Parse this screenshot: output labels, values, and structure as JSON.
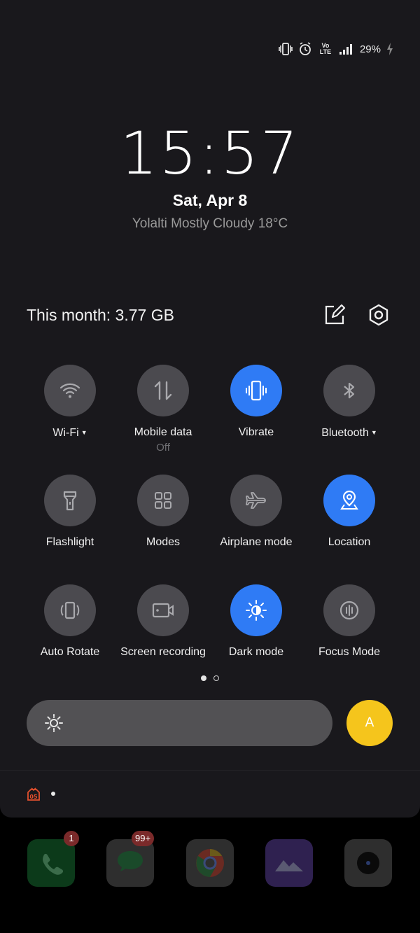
{
  "status_bar": {
    "network_label": "Vo LTE",
    "battery_percent": "29%",
    "icons": [
      "vibrate-icon",
      "alarm-icon",
      "volte-icon",
      "signal-icon",
      "battery-charging-icon"
    ]
  },
  "clock": {
    "time": "15:57",
    "date": "Sat, Apr 8",
    "weather": "Yolalti Mostly Cloudy 18°C"
  },
  "data_usage": {
    "text": "This month: 3.77 GB"
  },
  "toolbar": {
    "icons": [
      "edit-icon",
      "settings-icon"
    ]
  },
  "tiles": [
    {
      "label": "Wi-Fi",
      "icon": "wifi-icon",
      "active": false,
      "has_dropdown": true
    },
    {
      "label": "Mobile data",
      "sub": "Off",
      "icon": "mobile-data-icon",
      "active": false
    },
    {
      "label": "Vibrate",
      "icon": "vibrate-icon",
      "active": true
    },
    {
      "label": "Bluetooth",
      "icon": "bluetooth-icon",
      "active": false,
      "has_dropdown": true
    },
    {
      "label": "Flashlight",
      "icon": "flashlight-icon",
      "active": false
    },
    {
      "label": "Modes",
      "icon": "modes-icon",
      "active": false
    },
    {
      "label": "Airplane mode",
      "icon": "airplane-icon",
      "active": false
    },
    {
      "label": "Location",
      "icon": "location-icon",
      "active": true
    },
    {
      "label": "Auto Rotate",
      "icon": "auto-rotate-icon",
      "active": false
    },
    {
      "label": "Screen recording",
      "icon": "screen-recording-icon",
      "active": false
    },
    {
      "label": "Dark mode",
      "icon": "dark-mode-icon",
      "active": true
    },
    {
      "label": "Focus Mode",
      "icon": "focus-mode-icon",
      "active": false
    }
  ],
  "pager": {
    "pages": 2,
    "current": 1
  },
  "brightness": {
    "auto_label": "A",
    "auto_color": "#f5c51c"
  },
  "notification": {
    "app_icon_text": "05"
  },
  "dock": [
    {
      "app": "phone-app",
      "badge": "1"
    },
    {
      "app": "messages-app",
      "badge": "99+"
    },
    {
      "app": "chrome-app"
    },
    {
      "app": "gallery-app"
    },
    {
      "app": "camera-app"
    }
  ],
  "colors": {
    "panel_bg": "#19181c",
    "tile_off": "#4b4a4f",
    "tile_on": "#2f7bf5",
    "accent_yellow": "#f5c51c"
  }
}
